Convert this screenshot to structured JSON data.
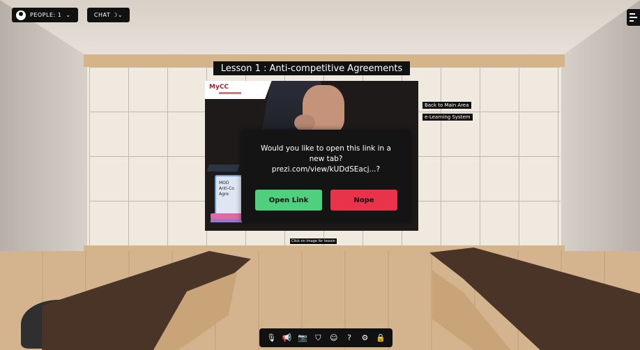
{
  "top_bar": {
    "people_label": "PEOPLE: 1",
    "people_chevron": "⌄",
    "chat_label": "CHAT",
    "chat_icon": "☽",
    "chat_chevron": "⌄"
  },
  "lesson": {
    "title": "Lesson 1 : Anti-competitive Agreements"
  },
  "wall_labels": {
    "back": "Back to Main Area",
    "elearning": "e-Learning System",
    "click_hint": "Click on image for lesson"
  },
  "slide": {
    "logo_text": "MyCC",
    "laptop_text_1": "MOD",
    "laptop_text_2": "Anti-Co",
    "laptop_text_3": "Agre"
  },
  "dialog": {
    "message_line1": "Would you like to open this link in a",
    "message_line2": "new tab?",
    "message_line3": "prezi.com/view/kUDdSEacj...?",
    "open_label": "Open Link",
    "nope_label": "Nope",
    "open_color": "#4fd07f",
    "nope_color": "#e8334b"
  },
  "toolbar": {
    "icons": [
      "mute-mic-icon",
      "megaphone-icon",
      "camera-icon",
      "seat-icon",
      "emoji-icon",
      "help-icon",
      "settings-icon",
      "lock-icon"
    ],
    "glyphs": {
      "mic": "🎙",
      "megaphone": "📢",
      "camera": "📷",
      "seat": "⛉",
      "emoji": "☺",
      "help": "?",
      "settings": "⚙",
      "lock": "🔒"
    }
  }
}
